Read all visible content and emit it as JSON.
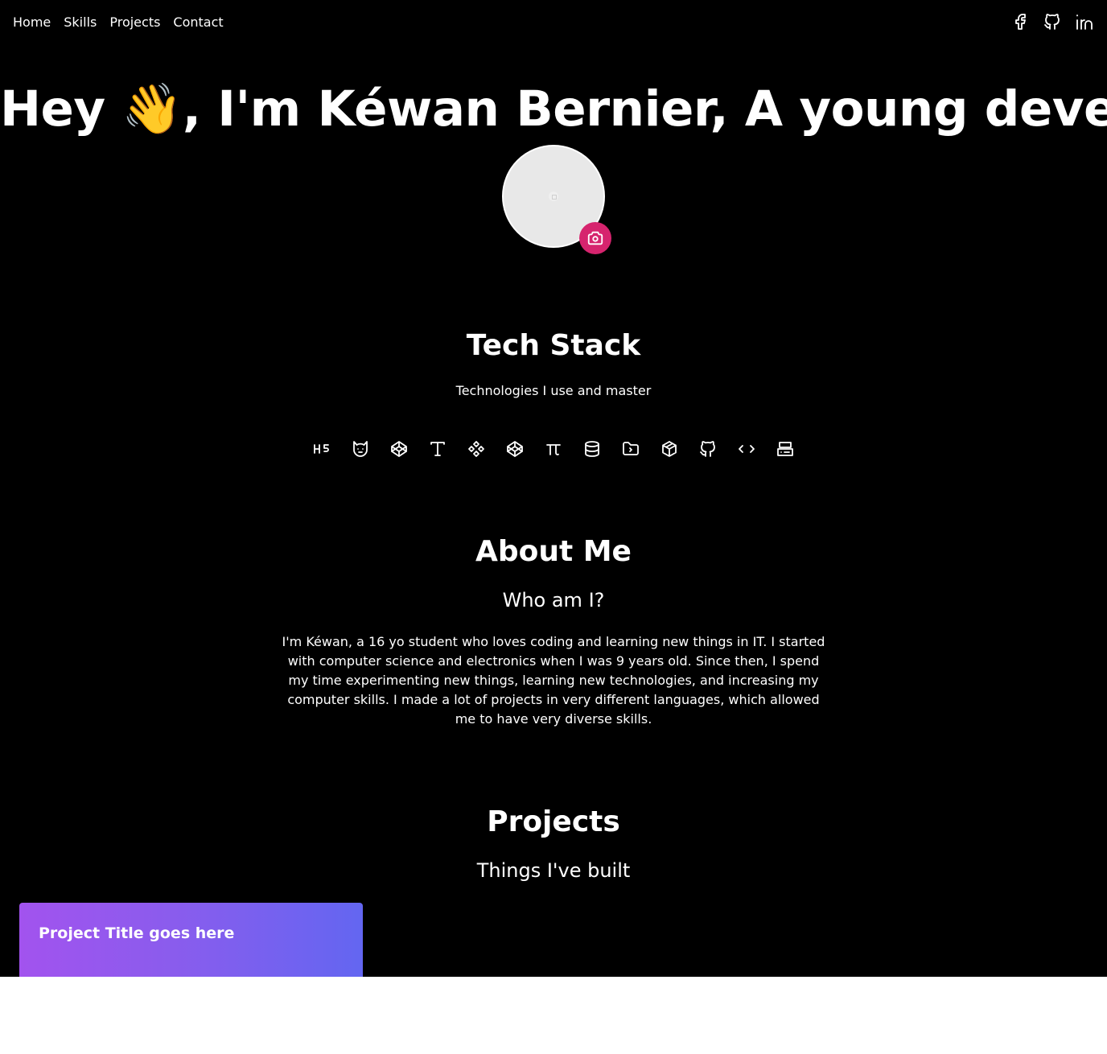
{
  "nav": {
    "items": [
      "Home",
      "Skills",
      "Projects",
      "Contact"
    ]
  },
  "social": {
    "icons": [
      "facebook-icon",
      "github-icon",
      "linkedin-icon"
    ]
  },
  "hero": {
    "title": "Hey 👋, I'm Kéwan Bernier, A young developer",
    "avatar_button_icon": "camera-icon",
    "avatar_button_color": "#d6246e"
  },
  "tech_stack": {
    "title": "Tech Stack",
    "subtitle": "Technologies I use and master",
    "icons": [
      "html5-icon",
      "cat-icon",
      "codepen-icon",
      "typescript-icon",
      "components-icon",
      "codepen-icon",
      "pi-icon",
      "database-icon",
      "folder-code-icon",
      "package-icon",
      "github-icon",
      "code-icon",
      "server-icon"
    ]
  },
  "about": {
    "title": "About Me",
    "subtitle": "Who am I?",
    "text": "I'm Kéwan, a 16 yo student who loves coding and learning new things in IT. I started with computer science and electronics when I was 9 years old. Since then, I spend my time experimenting new things, learning new technologies, and increasing my computer skills. I made a lot of projects in very different languages, which allowed me to have very diverse skills."
  },
  "projects": {
    "title": "Projects",
    "subtitle": "Things I've built",
    "cards": [
      {
        "title": "Project Title goes here",
        "gradient_from": "#a253ee",
        "gradient_to": "#6366f1"
      }
    ]
  },
  "colors": {
    "background": "#000000",
    "text": "#ffffff",
    "accent": "#d6246e"
  }
}
